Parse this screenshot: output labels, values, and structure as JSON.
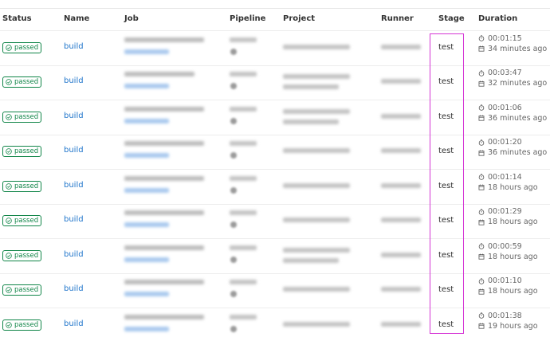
{
  "headers": {
    "status": "Status",
    "name": "Name",
    "job": "Job",
    "pipeline": "Pipeline",
    "project": "Project",
    "runner": "Runner",
    "stage": "Stage",
    "duration": "Duration"
  },
  "icons": {
    "status": "check-circle-icon",
    "duration": "timer-icon",
    "finished": "calendar-icon"
  },
  "colors": {
    "passed": "#108548",
    "link": "#1f75cb",
    "highlight": "#d535d5"
  },
  "rows": [
    {
      "status": "passed",
      "name": "build",
      "stage": "test",
      "duration": "00:01:15",
      "finished": "34 minutes ago"
    },
    {
      "status": "passed",
      "name": "build",
      "stage": "test",
      "duration": "00:03:47",
      "finished": "32 minutes ago"
    },
    {
      "status": "passed",
      "name": "build",
      "stage": "test",
      "duration": "00:01:06",
      "finished": "36 minutes ago"
    },
    {
      "status": "passed",
      "name": "build",
      "stage": "test",
      "duration": "00:01:20",
      "finished": "36 minutes ago"
    },
    {
      "status": "passed",
      "name": "build",
      "stage": "test",
      "duration": "00:01:14",
      "finished": "18 hours ago"
    },
    {
      "status": "passed",
      "name": "build",
      "stage": "test",
      "duration": "00:01:29",
      "finished": "18 hours ago"
    },
    {
      "status": "passed",
      "name": "build",
      "stage": "test",
      "duration": "00:00:59",
      "finished": "18 hours ago"
    },
    {
      "status": "passed",
      "name": "build",
      "stage": "test",
      "duration": "00:01:10",
      "finished": "18 hours ago"
    },
    {
      "status": "passed",
      "name": "build",
      "stage": "test",
      "duration": "00:01:38",
      "finished": "19 hours ago"
    }
  ]
}
